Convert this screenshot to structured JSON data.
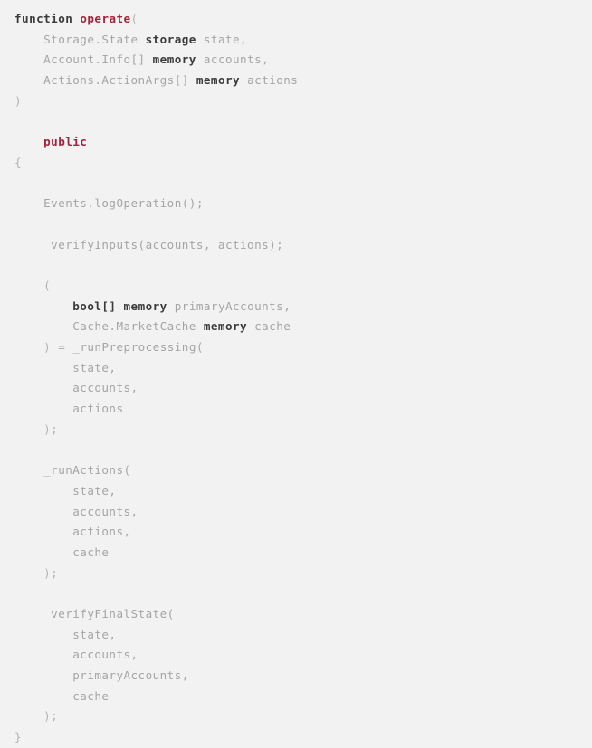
{
  "editor": {
    "language": "solidity",
    "background_color": "#f2f2f2",
    "palette": {
      "plain": "#a8a8a8",
      "keyword": "#3a3a3a",
      "type": "#3a3a3a",
      "modifier": "#9e2340",
      "function_name": "#a0243c",
      "punctuation": "#b3b3b3"
    },
    "lines": [
      {
        "indent": 0,
        "tokens": [
          {
            "text": "function",
            "role": "keyword"
          },
          {
            "text": " ",
            "role": "plain"
          },
          {
            "text": "operate",
            "role": "fnname"
          },
          {
            "text": "(",
            "role": "punct"
          }
        ]
      },
      {
        "indent": 1,
        "tokens": [
          {
            "text": "Storage.State",
            "role": "member"
          },
          {
            "text": " ",
            "role": "plain"
          },
          {
            "text": "storage",
            "role": "keyword"
          },
          {
            "text": " ",
            "role": "plain"
          },
          {
            "text": "state,",
            "role": "ident"
          }
        ]
      },
      {
        "indent": 1,
        "tokens": [
          {
            "text": "Account.Info[]",
            "role": "member"
          },
          {
            "text": " ",
            "role": "plain"
          },
          {
            "text": "memory",
            "role": "keyword"
          },
          {
            "text": " ",
            "role": "plain"
          },
          {
            "text": "accounts,",
            "role": "ident"
          }
        ]
      },
      {
        "indent": 1,
        "tokens": [
          {
            "text": "Actions.ActionArgs[]",
            "role": "member"
          },
          {
            "text": " ",
            "role": "plain"
          },
          {
            "text": "memory",
            "role": "keyword"
          },
          {
            "text": " ",
            "role": "plain"
          },
          {
            "text": "actions",
            "role": "ident"
          }
        ]
      },
      {
        "indent": 0,
        "tokens": [
          {
            "text": ")",
            "role": "punct"
          }
        ]
      },
      {
        "indent": 0,
        "tokens": []
      },
      {
        "indent": 1,
        "tokens": [
          {
            "text": "public",
            "role": "modifier"
          }
        ]
      },
      {
        "indent": 0,
        "tokens": [
          {
            "text": "{",
            "role": "punct"
          }
        ]
      },
      {
        "indent": 0,
        "tokens": []
      },
      {
        "indent": 1,
        "tokens": [
          {
            "text": "Events.logOperation();",
            "role": "ident"
          }
        ]
      },
      {
        "indent": 0,
        "tokens": []
      },
      {
        "indent": 1,
        "tokens": [
          {
            "text": "_verifyInputs(accounts, actions);",
            "role": "ident"
          }
        ]
      },
      {
        "indent": 0,
        "tokens": []
      },
      {
        "indent": 1,
        "tokens": [
          {
            "text": "(",
            "role": "punct"
          }
        ]
      },
      {
        "indent": 2,
        "tokens": [
          {
            "text": "bool[]",
            "role": "type"
          },
          {
            "text": " ",
            "role": "plain"
          },
          {
            "text": "memory",
            "role": "keyword"
          },
          {
            "text": " ",
            "role": "plain"
          },
          {
            "text": "primaryAccounts,",
            "role": "ident"
          }
        ]
      },
      {
        "indent": 2,
        "tokens": [
          {
            "text": "Cache.MarketCache",
            "role": "member"
          },
          {
            "text": " ",
            "role": "plain"
          },
          {
            "text": "memory",
            "role": "keyword"
          },
          {
            "text": " ",
            "role": "plain"
          },
          {
            "text": "cache",
            "role": "ident"
          }
        ]
      },
      {
        "indent": 1,
        "tokens": [
          {
            "text": ")",
            "role": "punct"
          },
          {
            "text": " ",
            "role": "plain"
          },
          {
            "text": "=",
            "role": "punct"
          },
          {
            "text": " ",
            "role": "plain"
          },
          {
            "text": "_runPreprocessing(",
            "role": "ident"
          }
        ]
      },
      {
        "indent": 2,
        "tokens": [
          {
            "text": "state,",
            "role": "ident"
          }
        ]
      },
      {
        "indent": 2,
        "tokens": [
          {
            "text": "accounts,",
            "role": "ident"
          }
        ]
      },
      {
        "indent": 2,
        "tokens": [
          {
            "text": "actions",
            "role": "ident"
          }
        ]
      },
      {
        "indent": 1,
        "tokens": [
          {
            "text": ");",
            "role": "punct"
          }
        ]
      },
      {
        "indent": 0,
        "tokens": []
      },
      {
        "indent": 1,
        "tokens": [
          {
            "text": "_runActions(",
            "role": "ident"
          }
        ]
      },
      {
        "indent": 2,
        "tokens": [
          {
            "text": "state,",
            "role": "ident"
          }
        ]
      },
      {
        "indent": 2,
        "tokens": [
          {
            "text": "accounts,",
            "role": "ident"
          }
        ]
      },
      {
        "indent": 2,
        "tokens": [
          {
            "text": "actions,",
            "role": "ident"
          }
        ]
      },
      {
        "indent": 2,
        "tokens": [
          {
            "text": "cache",
            "role": "ident"
          }
        ]
      },
      {
        "indent": 1,
        "tokens": [
          {
            "text": ");",
            "role": "punct"
          }
        ]
      },
      {
        "indent": 0,
        "tokens": []
      },
      {
        "indent": 1,
        "tokens": [
          {
            "text": "_verifyFinalState(",
            "role": "ident"
          }
        ]
      },
      {
        "indent": 2,
        "tokens": [
          {
            "text": "state,",
            "role": "ident"
          }
        ]
      },
      {
        "indent": 2,
        "tokens": [
          {
            "text": "accounts,",
            "role": "ident"
          }
        ]
      },
      {
        "indent": 2,
        "tokens": [
          {
            "text": "primaryAccounts,",
            "role": "ident"
          }
        ]
      },
      {
        "indent": 2,
        "tokens": [
          {
            "text": "cache",
            "role": "ident"
          }
        ]
      },
      {
        "indent": 1,
        "tokens": [
          {
            "text": ");",
            "role": "punct"
          }
        ]
      },
      {
        "indent": 0,
        "tokens": [
          {
            "text": "}",
            "role": "punct"
          }
        ]
      }
    ]
  }
}
